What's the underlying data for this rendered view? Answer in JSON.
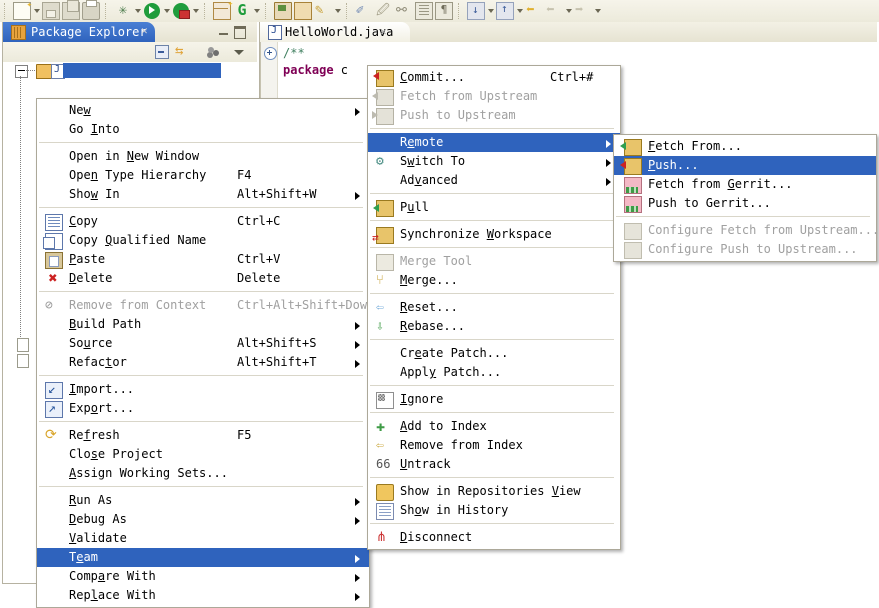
{
  "toolbar": {
    "groups": [
      {
        "items": [
          {
            "name": "new-wizard",
            "icon": "new-file-icon",
            "dropdown": true
          },
          {
            "name": "save",
            "icon": "save-icon",
            "dropdown": false
          },
          {
            "name": "save-all",
            "icon": "save-all-icon",
            "dropdown": false
          },
          {
            "name": "print",
            "icon": "print-icon",
            "dropdown": false
          }
        ]
      },
      {
        "items": [
          {
            "name": "debug",
            "icon": "debug-bug-icon",
            "dropdown": true
          },
          {
            "name": "run",
            "icon": "run-play-icon",
            "dropdown": true
          },
          {
            "name": "external-tools",
            "icon": "external-tools-icon",
            "dropdown": true
          }
        ]
      },
      {
        "items": [
          {
            "name": "new-java-package",
            "icon": "new-package-icon",
            "dropdown": false
          },
          {
            "name": "new-java-class",
            "icon": "new-class-icon",
            "dropdown": true
          }
        ]
      },
      {
        "items": [
          {
            "name": "open-type",
            "icon": "open-type-icon",
            "dropdown": false
          },
          {
            "name": "open-task",
            "icon": "open-task-icon",
            "dropdown": false
          },
          {
            "name": "search",
            "icon": "search-pencil-icon",
            "dropdown": true
          }
        ]
      },
      {
        "items": [
          {
            "name": "last-edit-location",
            "icon": "last-edit-icon",
            "dropdown": false
          },
          {
            "name": "toggle-mark-occurrences",
            "icon": "mark-occurrences-icon",
            "dropdown": false
          },
          {
            "name": "show-whitespace",
            "icon": "whitespace-icon",
            "dropdown": false
          },
          {
            "name": "show-pilcrow",
            "icon": "pilcrow-icon",
            "dropdown": false
          }
        ]
      },
      {
        "items": [
          {
            "name": "next-annotation",
            "icon": "next-annotation-icon",
            "dropdown": true
          },
          {
            "name": "previous-annotation",
            "icon": "previous-annotation-icon",
            "dropdown": true
          },
          {
            "name": "back-to-marker",
            "icon": "back-marker-icon",
            "dropdown": false
          },
          {
            "name": "back",
            "icon": "back-arrow-icon",
            "dropdown": true
          },
          {
            "name": "forward",
            "icon": "forward-arrow-icon",
            "dropdown": true
          }
        ]
      }
    ]
  },
  "package_explorer": {
    "tab_label": "Package Explorer",
    "tab_icon": "package-explorer-icon",
    "close_glyph": "✕",
    "view_toolbar": [
      {
        "name": "collapse-all-button",
        "icon": "collapse-all-icon"
      },
      {
        "name": "link-with-editor-button",
        "icon": "link-editor-icon"
      },
      {
        "name": "view-menu-button",
        "icon": "view-menu-icon"
      },
      {
        "name": "view-dropdown-button",
        "icon": "chevron-down-icon"
      }
    ]
  },
  "editor": {
    "tab_label": "HelloWorld.java",
    "tab_icon": "java-file-icon",
    "close_glyph": "✕",
    "code": {
      "line1": "/**",
      "line2_keyword": "package",
      "line2_rest": " c"
    }
  },
  "context_menu": {
    "name": "package-explorer-context-menu",
    "items": [
      {
        "label": "New",
        "accel": "",
        "submenu": true,
        "icon": "",
        "enabled": true,
        "mnemonic": "w"
      },
      {
        "label": "Go Into",
        "accel": "",
        "submenu": false,
        "icon": "",
        "enabled": true,
        "mnemonic": "I"
      },
      {
        "separator": true
      },
      {
        "label": "Open in New Window",
        "accel": "",
        "submenu": false,
        "icon": "",
        "enabled": true,
        "mnemonic": "N"
      },
      {
        "label": "Open Type Hierarchy",
        "accel": "F4",
        "submenu": false,
        "icon": "",
        "enabled": true,
        "mnemonic": "n"
      },
      {
        "label": "Show In",
        "accel": "Alt+Shift+W",
        "submenu": true,
        "icon": "",
        "enabled": true,
        "mnemonic": "w"
      },
      {
        "separator": true
      },
      {
        "label": "Copy",
        "accel": "Ctrl+C",
        "submenu": false,
        "icon": "copy-icon",
        "enabled": true,
        "mnemonic": "C"
      },
      {
        "label": "Copy Qualified Name",
        "accel": "",
        "submenu": false,
        "icon": "copy-qualified-icon",
        "enabled": true,
        "mnemonic": "Q"
      },
      {
        "label": "Paste",
        "accel": "Ctrl+V",
        "submenu": false,
        "icon": "paste-icon",
        "enabled": true,
        "mnemonic": "P"
      },
      {
        "label": "Delete",
        "accel": "Delete",
        "submenu": false,
        "icon": "delete-x-icon",
        "enabled": true,
        "mnemonic": "D"
      },
      {
        "separator": true
      },
      {
        "label": "Remove from Context",
        "accel": "Ctrl+Alt+Shift+Down",
        "submenu": false,
        "icon": "remove-context-icon",
        "enabled": false
      },
      {
        "label": "Build Path",
        "accel": "",
        "submenu": true,
        "icon": "",
        "enabled": true,
        "mnemonic": "B"
      },
      {
        "label": "Source",
        "accel": "Alt+Shift+S",
        "submenu": true,
        "icon": "",
        "enabled": true,
        "mnemonic": "u"
      },
      {
        "label": "Refactor",
        "accel": "Alt+Shift+T",
        "submenu": true,
        "icon": "",
        "enabled": true,
        "mnemonic": "t"
      },
      {
        "separator": true
      },
      {
        "label": "Import...",
        "accel": "",
        "submenu": false,
        "icon": "import-icon",
        "enabled": true,
        "mnemonic": "I"
      },
      {
        "label": "Export...",
        "accel": "",
        "submenu": false,
        "icon": "export-icon",
        "enabled": true,
        "mnemonic": "o"
      },
      {
        "separator": true
      },
      {
        "label": "Refresh",
        "accel": "F5",
        "submenu": false,
        "icon": "refresh-icon",
        "enabled": true,
        "mnemonic": "f"
      },
      {
        "label": "Close Project",
        "accel": "",
        "submenu": false,
        "icon": "",
        "enabled": true,
        "mnemonic": "s"
      },
      {
        "label": "Assign Working Sets...",
        "accel": "",
        "submenu": false,
        "icon": "",
        "enabled": true,
        "mnemonic": "A"
      },
      {
        "separator": true
      },
      {
        "label": "Run As",
        "accel": "",
        "submenu": true,
        "icon": "",
        "enabled": true,
        "mnemonic": "R"
      },
      {
        "label": "Debug As",
        "accel": "",
        "submenu": true,
        "icon": "",
        "enabled": true,
        "mnemonic": "D"
      },
      {
        "label": "Validate",
        "accel": "",
        "submenu": false,
        "icon": "",
        "enabled": true,
        "mnemonic": "V"
      },
      {
        "label": "Team",
        "accel": "",
        "submenu": true,
        "icon": "",
        "enabled": true,
        "selected": true,
        "mnemonic": "e"
      },
      {
        "label": "Compare With",
        "accel": "",
        "submenu": true,
        "icon": "",
        "enabled": true,
        "mnemonic": "a"
      },
      {
        "label": "Replace With",
        "accel": "",
        "submenu": true,
        "icon": "",
        "enabled": true,
        "mnemonic": "l"
      }
    ]
  },
  "team_menu": {
    "name": "team-submenu",
    "items": [
      {
        "label": "Commit...",
        "accel": "Ctrl+#",
        "submenu": false,
        "icon": "commit-icon",
        "enabled": true,
        "mnemonic": "C"
      },
      {
        "label": "Fetch from Upstream",
        "accel": "",
        "submenu": false,
        "icon": "fetch-upstream-icon",
        "enabled": false
      },
      {
        "label": "Push to Upstream",
        "accel": "",
        "submenu": false,
        "icon": "push-upstream-icon",
        "enabled": false
      },
      {
        "separator": true
      },
      {
        "label": "Remote",
        "accel": "",
        "submenu": true,
        "icon": "",
        "enabled": true,
        "selected": true,
        "mnemonic": "e"
      },
      {
        "label": "Switch To",
        "accel": "",
        "submenu": true,
        "icon": "switch-to-icon",
        "enabled": true,
        "mnemonic": "w"
      },
      {
        "label": "Advanced",
        "accel": "",
        "submenu": true,
        "icon": "",
        "enabled": true,
        "mnemonic": "v"
      },
      {
        "separator": true
      },
      {
        "label": "Pull",
        "accel": "",
        "submenu": false,
        "icon": "pull-icon",
        "enabled": true,
        "mnemonic": "u"
      },
      {
        "separator": true
      },
      {
        "label": "Synchronize Workspace",
        "accel": "",
        "submenu": false,
        "icon": "synchronize-icon",
        "enabled": true,
        "mnemonic": "W"
      },
      {
        "separator": true
      },
      {
        "label": "Merge Tool",
        "accel": "",
        "submenu": false,
        "icon": "merge-tool-icon",
        "enabled": false
      },
      {
        "label": "Merge...",
        "accel": "",
        "submenu": false,
        "icon": "merge-icon",
        "enabled": true,
        "mnemonic": "M"
      },
      {
        "separator": true
      },
      {
        "label": "Reset...",
        "accel": "",
        "submenu": false,
        "icon": "reset-icon",
        "enabled": true,
        "mnemonic": "R"
      },
      {
        "label": "Rebase...",
        "accel": "",
        "submenu": false,
        "icon": "rebase-icon",
        "enabled": true,
        "mnemonic": "R"
      },
      {
        "separator": true
      },
      {
        "label": "Create Patch...",
        "accel": "",
        "submenu": false,
        "icon": "",
        "enabled": true,
        "mnemonic": "e"
      },
      {
        "label": "Apply Patch...",
        "accel": "",
        "submenu": false,
        "icon": "",
        "enabled": true,
        "mnemonic": "y"
      },
      {
        "separator": true
      },
      {
        "label": "Ignore",
        "accel": "",
        "submenu": false,
        "icon": "ignore-icon",
        "enabled": true,
        "mnemonic": "I"
      },
      {
        "separator": true
      },
      {
        "label": "Add to Index",
        "accel": "",
        "submenu": false,
        "icon": "add-to-index-icon",
        "enabled": true,
        "mnemonic": "A"
      },
      {
        "label": "Remove from Index",
        "accel": "",
        "submenu": false,
        "icon": "remove-from-index-icon",
        "enabled": true
      },
      {
        "label": "Untrack",
        "accel": "",
        "submenu": false,
        "icon": "untrack-icon",
        "enabled": true,
        "mnemonic": "U"
      },
      {
        "separator": true
      },
      {
        "label": "Show in Repositories View",
        "accel": "",
        "submenu": false,
        "icon": "repositories-icon",
        "enabled": true,
        "mnemonic": "V"
      },
      {
        "label": "Show in History",
        "accel": "",
        "submenu": false,
        "icon": "history-icon",
        "enabled": true,
        "mnemonic": "o"
      },
      {
        "separator": true
      },
      {
        "label": "Disconnect",
        "accel": "",
        "submenu": false,
        "icon": "disconnect-icon",
        "enabled": true,
        "mnemonic": "D"
      }
    ]
  },
  "remote_menu": {
    "name": "remote-submenu",
    "items": [
      {
        "label": "Fetch From...",
        "accel": "",
        "submenu": false,
        "icon": "fetch-from-icon",
        "enabled": true,
        "mnemonic": "F"
      },
      {
        "label": "Push...",
        "accel": "",
        "submenu": false,
        "icon": "push-icon",
        "enabled": true,
        "selected": true,
        "mnemonic": "P"
      },
      {
        "label": "Fetch from Gerrit...",
        "accel": "",
        "submenu": false,
        "icon": "fetch-gerrit-icon",
        "enabled": true,
        "mnemonic": "G"
      },
      {
        "label": "Push to Gerrit...",
        "accel": "",
        "submenu": false,
        "icon": "push-gerrit-icon",
        "enabled": true
      },
      {
        "separator": true
      },
      {
        "label": "Configure Fetch from Upstream...",
        "accel": "",
        "submenu": false,
        "icon": "configure-fetch-icon",
        "enabled": false
      },
      {
        "label": "Configure Push to Upstream...",
        "accel": "",
        "submenu": false,
        "icon": "configure-push-icon",
        "enabled": false
      }
    ]
  },
  "colors": {
    "menu_highlight": "#2f63bd",
    "menu_bg": "#ffffff",
    "menu_border": "#aca899",
    "disabled_text": "#a0a0a0",
    "toolbar_bg": "#eceadb",
    "tab_active": "#2f63bd"
  }
}
